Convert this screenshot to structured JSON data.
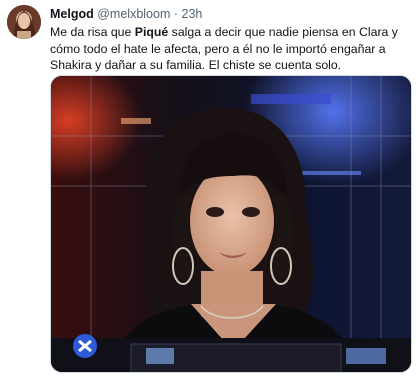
{
  "tweet": {
    "author_name": "Melgod",
    "handle": "@melxbloom",
    "separator": "·",
    "time": "23h",
    "text_before": "Me da risa que ",
    "text_bold": "Piqué",
    "text_after": " salga a decir que nadie piensa en Clara y cómo todo el hate le afecta, pero a él no le importó engañar a Shakira y dañar a su familia. El chiste se cuenta solo.",
    "media": {
      "kind": "video-still",
      "subject": "woman with dark fringe hair seated at TV studio desk"
    }
  },
  "colors": {
    "text_primary": "#0f1419",
    "text_secondary": "#536471",
    "media_border": "#cfd9de"
  }
}
